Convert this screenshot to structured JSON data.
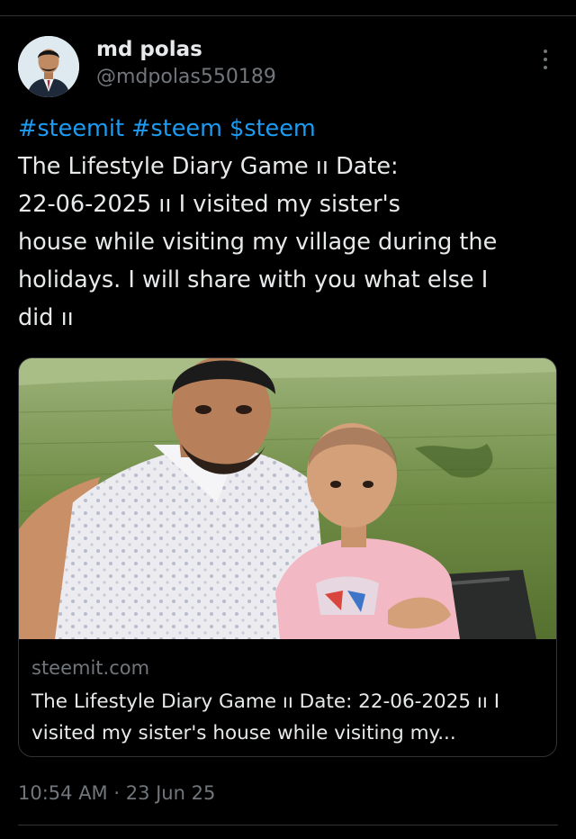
{
  "author": {
    "display_name": "md polas",
    "handle": "@mdpolas550189"
  },
  "tweet": {
    "hashtags": [
      "#steemit",
      "#steem",
      "$steem"
    ],
    "lines": [
      "The Lifestyle Diary Game ıı Date:",
      "22-06-2025 ıı I visited my sister's",
      "house while visiting my village during the",
      "holidays. I will share with you what else I",
      "did ıı"
    ]
  },
  "link_card": {
    "domain": "steemit.com",
    "title_lines": [
      "The Lifestyle Diary Game ıı Date: 22-06-2025 ıı I",
      "visited my sister's house while visiting my..."
    ]
  },
  "meta": {
    "timestamp": "10:54 AM · 23 Jun 25"
  },
  "colors": {
    "background": "#000000",
    "text": "#e7e9ea",
    "secondary": "#71767b",
    "link": "#1d9bf0",
    "border": "#2f3336"
  },
  "icons": {
    "more": "more-vertical-icon"
  }
}
